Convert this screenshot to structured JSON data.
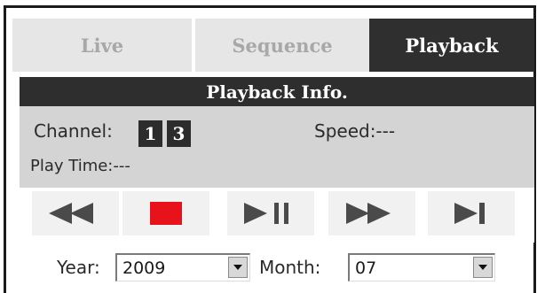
{
  "tabs": [
    {
      "label": "Live",
      "active": false
    },
    {
      "label": "Sequence",
      "active": false
    },
    {
      "label": "Playback",
      "active": true
    }
  ],
  "info": {
    "header": "Playback Info.",
    "channel_label": "Channel:",
    "channels": [
      "1",
      "3"
    ],
    "speed_label": "Speed:",
    "speed_value": "---",
    "speed_text": "Speed:---",
    "play_time_text": "Play Time:---"
  },
  "controls": [
    {
      "icon": "rewind-icon"
    },
    {
      "icon": "stop-icon"
    },
    {
      "icon": "play-pause-icon"
    },
    {
      "icon": "fast-forward-icon"
    },
    {
      "icon": "skip-to-end-icon"
    }
  ],
  "date": {
    "year_label": "Year:",
    "year_value": "2009",
    "month_label": "Month:",
    "month_value": "07"
  },
  "colors": {
    "active_tab": "#2f2f2f",
    "inactive_tab": "#e6e6e6",
    "inactive_tab_text": "#a8a8a8",
    "panel": "#d4d4d4",
    "stop": "#e8131a",
    "control_glyph": "#4a4a4a"
  }
}
